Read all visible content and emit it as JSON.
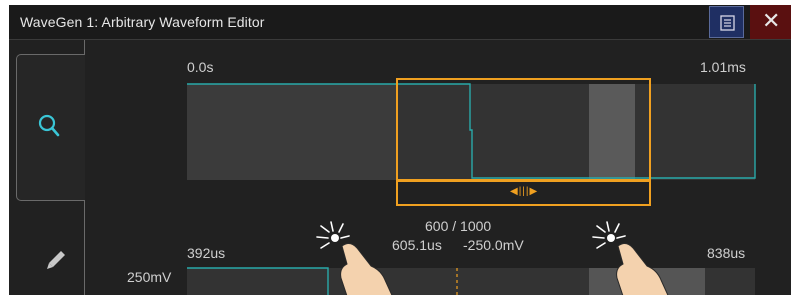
{
  "window": {
    "title": "WaveGen 1: Arbitrary Waveform Editor",
    "menu_icon": "list-icon",
    "close_label": "✕"
  },
  "sidebar": {
    "tabs": [
      {
        "icon": "magnifier-icon",
        "selected": true
      },
      {
        "icon": "pencil-icon",
        "selected": false
      }
    ]
  },
  "overview": {
    "start_label": "0.0s",
    "end_label": "1.01ms"
  },
  "cursor": {
    "point": "600 / 1000",
    "time": "605.1us",
    "voltage": "-250.0mV"
  },
  "detail": {
    "start_label": "392us",
    "end_label": "838us",
    "y_label": "250mV"
  },
  "colors": {
    "waveform": "#29a9a9",
    "selection": "#f0a020",
    "accent": "#3ac6d6"
  }
}
